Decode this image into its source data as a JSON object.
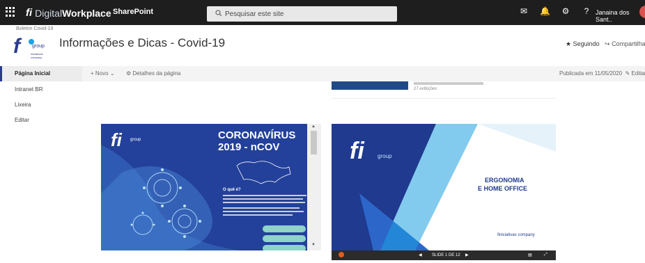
{
  "topbar": {
    "brand_fi": "fi",
    "brand_digital": "Digital",
    "brand_workplace": "Workplace",
    "sharepoint": "SharePoint",
    "search_placeholder": "Pesquisar este site",
    "user_name": "Janaina dos Sant.."
  },
  "header": {
    "breadcrumb": "Boletim Covid-19",
    "logo_group": "group",
    "logo_sub": "Iniciativas company",
    "title": "Informações e Dicas - Covid-19",
    "follow_label": "Seguindo",
    "share_label": "Compartilhar"
  },
  "nav": {
    "items": [
      {
        "label": "Página Inicial"
      },
      {
        "label": "Intranet BR"
      },
      {
        "label": "Lixeira"
      },
      {
        "label": "Editar"
      }
    ]
  },
  "commandbar": {
    "new_label": "Novo",
    "details_label": "Detalhes da página",
    "published": "Publicada em 11/05/2020",
    "edit_label": "Editar"
  },
  "news": {
    "views": "27 exibições"
  },
  "doc1": {
    "logo": "fi",
    "group": "group",
    "title1": "CORONAVÍRUS",
    "title2": "2019 - nCOV",
    "question": "O quê é?"
  },
  "doc2": {
    "logo": "fi",
    "group": "group",
    "title1": "ERGONOMIA",
    "title2": "E HOME OFFICE",
    "company": "finiciativas company",
    "slide_label": "SLIDE 1 DE 12"
  },
  "colors": {
    "topbar": "#1e1e1e",
    "brand_blue": "#2a3a8c",
    "accent": "#1fa0e6"
  }
}
